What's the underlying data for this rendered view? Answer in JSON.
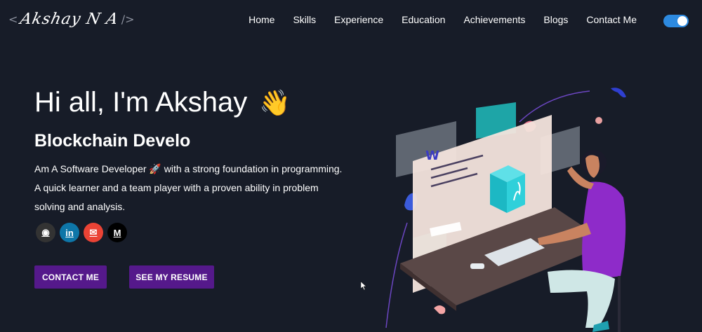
{
  "header": {
    "logo": {
      "open_bracket": "<",
      "signature": "Akshay N A",
      "close_bracket": "/>"
    },
    "nav": [
      {
        "label": "Home"
      },
      {
        "label": "Skills"
      },
      {
        "label": "Experience"
      },
      {
        "label": "Education"
      },
      {
        "label": "Achievements"
      },
      {
        "label": "Blogs"
      },
      {
        "label": "Contact Me"
      }
    ],
    "theme_toggle": {
      "state": "on",
      "color": "#2d8ae0"
    }
  },
  "hero": {
    "greeting": "Hi all, I'm Akshay",
    "wave_emoji": "👋",
    "subtitle": "Blockchain Develo",
    "description": "Am A Software Developer 🚀 with a strong foundation in programming. A quick learner and a team player with a proven ability in problem solving and analysis.",
    "socials": [
      {
        "name": "github-icon",
        "glyph": "◉",
        "color": "#333333"
      },
      {
        "name": "linkedin-icon",
        "glyph": "in",
        "color": "#0e76a8"
      },
      {
        "name": "mail-icon",
        "glyph": "✉",
        "color": "#ea4335"
      },
      {
        "name": "medium-icon",
        "glyph": "M",
        "color": "#000000"
      }
    ],
    "buttons": {
      "contact": "CONTACT ME",
      "resume": "SEE MY RESUME"
    },
    "illustration": {
      "board_letter": "W"
    }
  },
  "colors": {
    "background": "#171c28",
    "button": "#55198b",
    "accent": "#2d8ae0"
  }
}
